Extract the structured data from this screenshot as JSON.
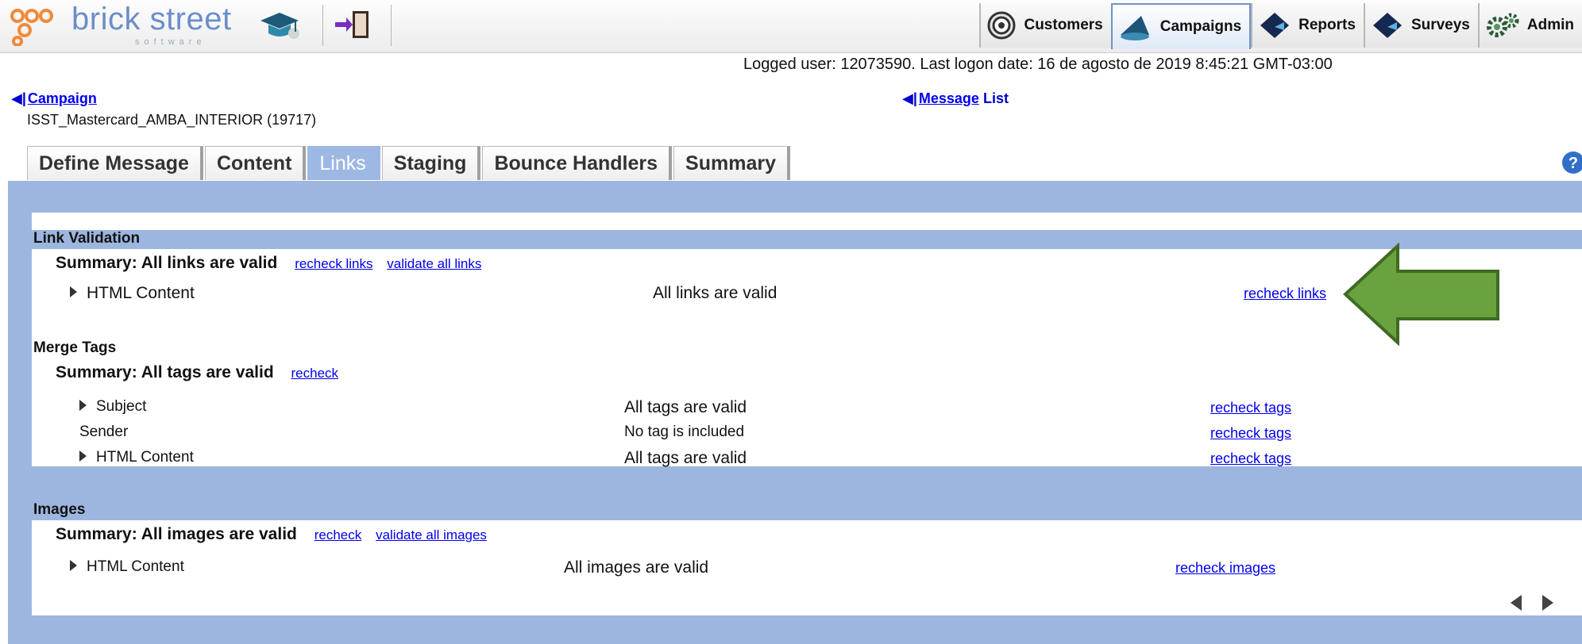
{
  "app": {
    "logo_text": "brick street",
    "logo_sub": "software"
  },
  "nav": {
    "tabs": [
      {
        "label": "Customers",
        "icon": "target-icon"
      },
      {
        "label": "Campaigns",
        "icon": "megaphone-icon",
        "active": true
      },
      {
        "label": "Reports",
        "icon": "chart-book-icon"
      },
      {
        "label": "Surveys",
        "icon": "survey-book-icon"
      },
      {
        "label": "Admin",
        "icon": "gears-icon"
      }
    ]
  },
  "info": {
    "logged_user": "Logged user: 12073590. Last logon date: 16 de agosto de 2019 8:45:21 GMT-03:00"
  },
  "breadcrumb": {
    "campaign_label": "Campaign",
    "campaign_name": "ISST_Mastercard_AMBA_INTERIOR (19717)",
    "message_label": "Message",
    "list_label": "List"
  },
  "tabs": {
    "define_message": "Define Message",
    "content": "Content",
    "links": "Links",
    "staging": "Staging",
    "bounce_handlers": "Bounce Handlers",
    "summary": "Summary"
  },
  "sections": {
    "link_validation": {
      "title": "Link Validation",
      "summary": "Summary:  All links are valid",
      "recheck": "recheck links",
      "validate_all": "validate all links",
      "rows": [
        {
          "name": "HTML Content",
          "status": "All links are valid",
          "action": "recheck links"
        }
      ]
    },
    "merge_tags": {
      "title": "Merge Tags",
      "summary": "Summary:  All tags are valid",
      "recheck": "recheck",
      "rows": [
        {
          "name": "Subject",
          "status": "All tags are valid",
          "action": "recheck tags"
        },
        {
          "name": "Sender",
          "status": "No tag is included",
          "action": "recheck tags"
        },
        {
          "name": "HTML Content",
          "status": "All tags are valid",
          "action": "recheck tags"
        }
      ]
    },
    "images": {
      "title": "Images",
      "summary": "Summary:  All images are valid",
      "recheck": "recheck",
      "validate_all": "validate all images",
      "rows": [
        {
          "name": "HTML Content",
          "status": "All images are valid",
          "action": "recheck images"
        }
      ]
    }
  },
  "colors": {
    "panel": "#9db6df",
    "active_tab": "#9db8e2",
    "link": "#0000ee",
    "arrow_fill": "#6aa23f",
    "arrow_stroke": "#3f6b22"
  }
}
